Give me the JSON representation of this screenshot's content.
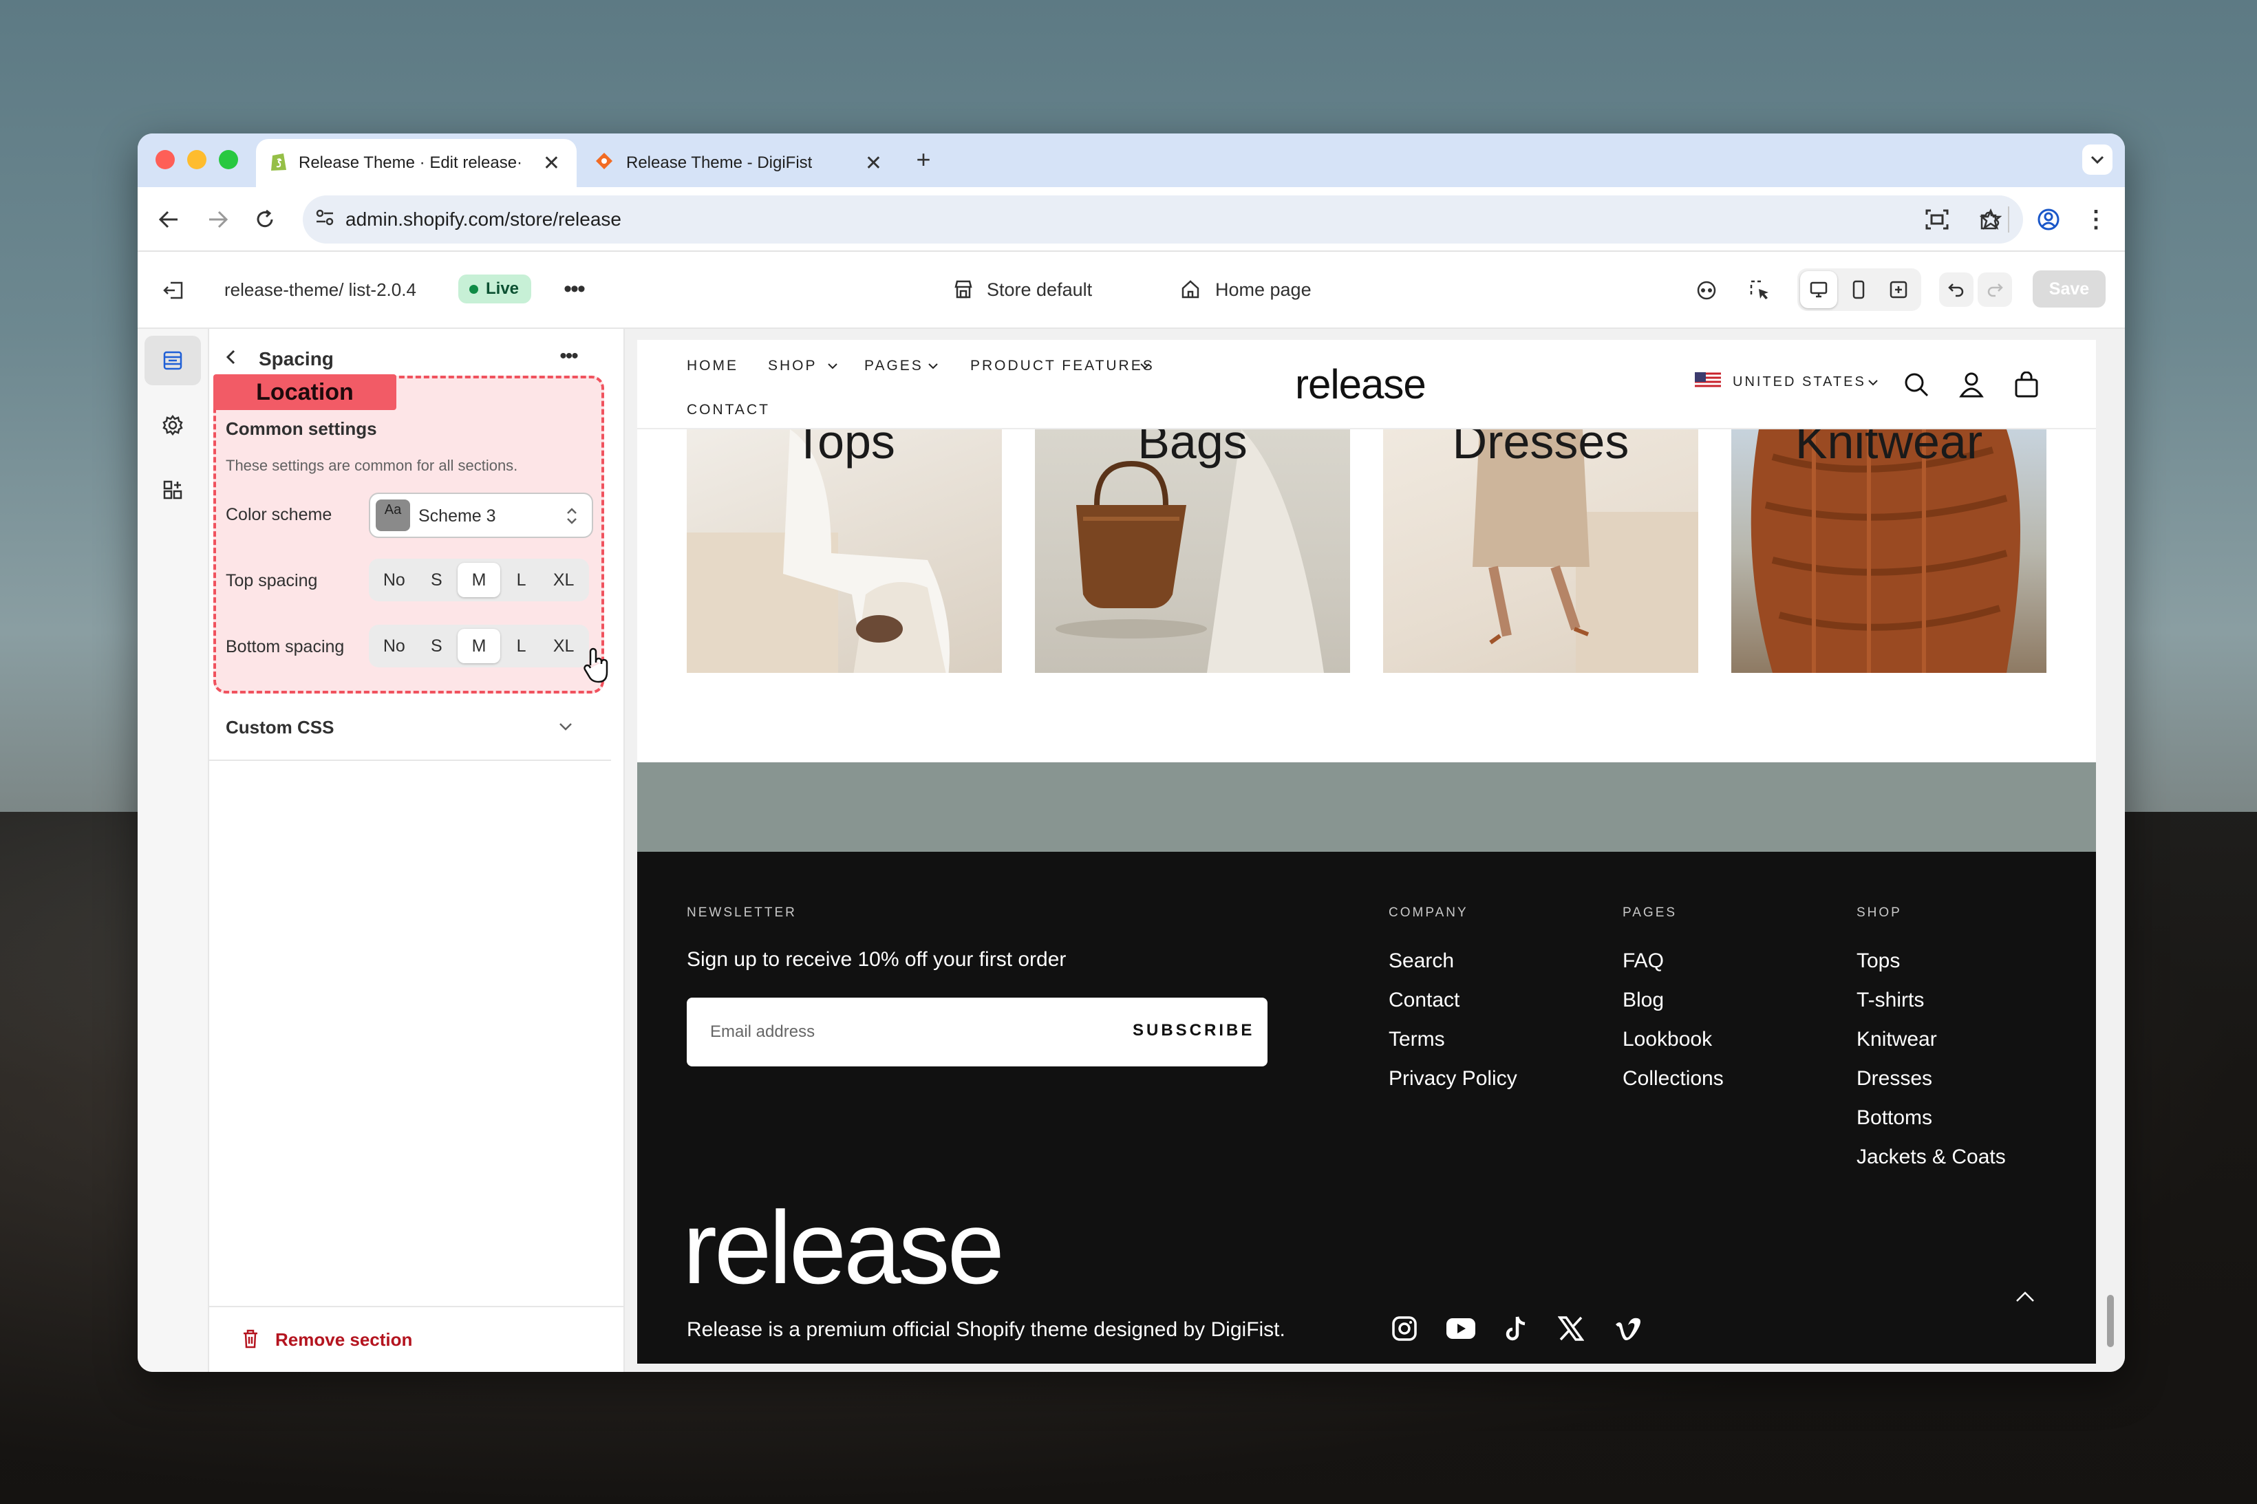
{
  "browser": {
    "tabs": [
      {
        "title": "Release Theme · Edit release·",
        "active": true
      },
      {
        "title": "Release Theme - DigiFist",
        "active": false
      }
    ],
    "url": "admin.shopify.com/store/release"
  },
  "editor": {
    "theme_path": "release-theme/ list-2.0.4",
    "status": "Live",
    "store_selector": "Store default",
    "page_selector": "Home page",
    "save_label": "Save"
  },
  "panel": {
    "back_title": "Spacing",
    "highlight_label": "Location",
    "section_title": "Common settings",
    "section_desc": "These settings are common for all sections.",
    "color_scheme_label": "Color scheme",
    "color_scheme_value": "Scheme 3",
    "color_scheme_swatch": "Aa",
    "top_spacing_label": "Top spacing",
    "bottom_spacing_label": "Bottom spacing",
    "spacing_options": [
      "No",
      "S",
      "M",
      "L",
      "XL"
    ],
    "top_spacing_selected": "M",
    "bottom_spacing_selected": "M",
    "custom_css_label": "Custom CSS",
    "remove_label": "Remove section"
  },
  "site": {
    "nav": [
      "HOME",
      "SHOP",
      "PAGES",
      "PRODUCT FEATURES",
      "CONTACT"
    ],
    "logo": "release",
    "country": "UNITED STATES",
    "categories": [
      "Tops",
      "Bags",
      "Dresses",
      "Knitwear"
    ],
    "footer": {
      "newsletter_heading": "NEWSLETTER",
      "newsletter_text": "Sign up to receive 10% off your first order",
      "email_placeholder": "Email address",
      "subscribe_label": "SUBSCRIBE",
      "columns": [
        {
          "heading": "COMPANY",
          "links": [
            "Search",
            "Contact",
            "Terms",
            "Privacy Policy"
          ]
        },
        {
          "heading": "PAGES",
          "links": [
            "FAQ",
            "Blog",
            "Lookbook",
            "Collections"
          ]
        },
        {
          "heading": "SHOP",
          "links": [
            "Tops",
            "T-shirts",
            "Knitwear",
            "Dresses",
            "Bottoms",
            "Jackets & Coats"
          ]
        }
      ],
      "big_logo": "release",
      "tagline": "Release is a premium official Shopify theme designed by DigiFist.",
      "social_icons": [
        "instagram-icon",
        "youtube-icon",
        "tiktok-icon",
        "x-icon",
        "vimeo-icon"
      ]
    }
  },
  "colors": {
    "accent_blue": "#d6e3f7",
    "live_green": "#0f8b46",
    "highlight_red": "#f25b66",
    "danger": "#b4141f",
    "footer_bg": "#111111",
    "band": "#889591"
  }
}
